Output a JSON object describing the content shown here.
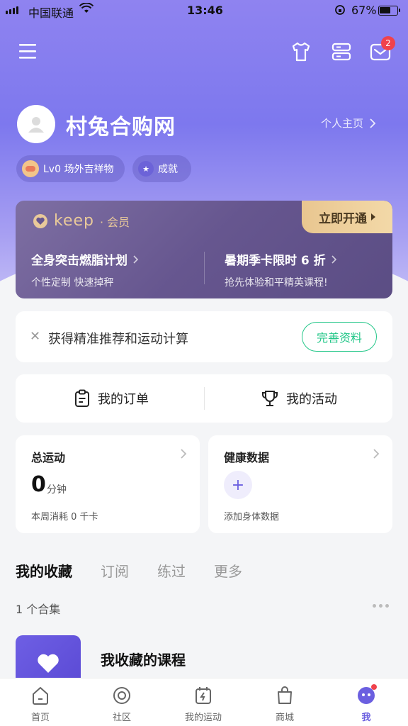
{
  "status_bar": {
    "carrier": "中国联通",
    "time": "13:46",
    "battery_percent": "67%",
    "battery_level": 0.67
  },
  "header": {
    "mail_badge_count": "2"
  },
  "profile": {
    "username": "村兔合购网",
    "homepage_link": "个人主页",
    "level_label": "Lv0 场外吉祥物",
    "achievement_label": "成就"
  },
  "member_card": {
    "brand": "keep",
    "brand_suffix": "· 会员",
    "join_button": "立即开通",
    "offer_left": {
      "title": "全身突击燃脂计划",
      "subtitle": "个性定制 快速掉秤"
    },
    "offer_right": {
      "title": "暑期季卡限时 6 折",
      "subtitle": "抢先体验和平精英课程!"
    }
  },
  "profile_tip": {
    "text": "获得精准推荐和运动计算",
    "button": "完善资料"
  },
  "quick_links": {
    "orders": "我的订单",
    "activities": "我的活动"
  },
  "stats": {
    "sport": {
      "title": "总运动",
      "value": "0",
      "unit": "分钟",
      "subtitle": "本周消耗 0 千卡"
    },
    "health": {
      "title": "健康数据",
      "add_label": "添加身体数据"
    }
  },
  "favorites": {
    "tabs": [
      "我的收藏",
      "订阅",
      "练过",
      "更多"
    ],
    "count_label": "1 个合集",
    "item_title": "我收藏的课程"
  },
  "tabbar": {
    "items": [
      "首页",
      "社区",
      "我的运动",
      "商城",
      "我"
    ],
    "active": "我"
  },
  "colors": {
    "brand_purple": "#6b5fe0",
    "accent_green": "#24c789",
    "badge_red": "#f0424c",
    "gold": "#e9c99a"
  }
}
